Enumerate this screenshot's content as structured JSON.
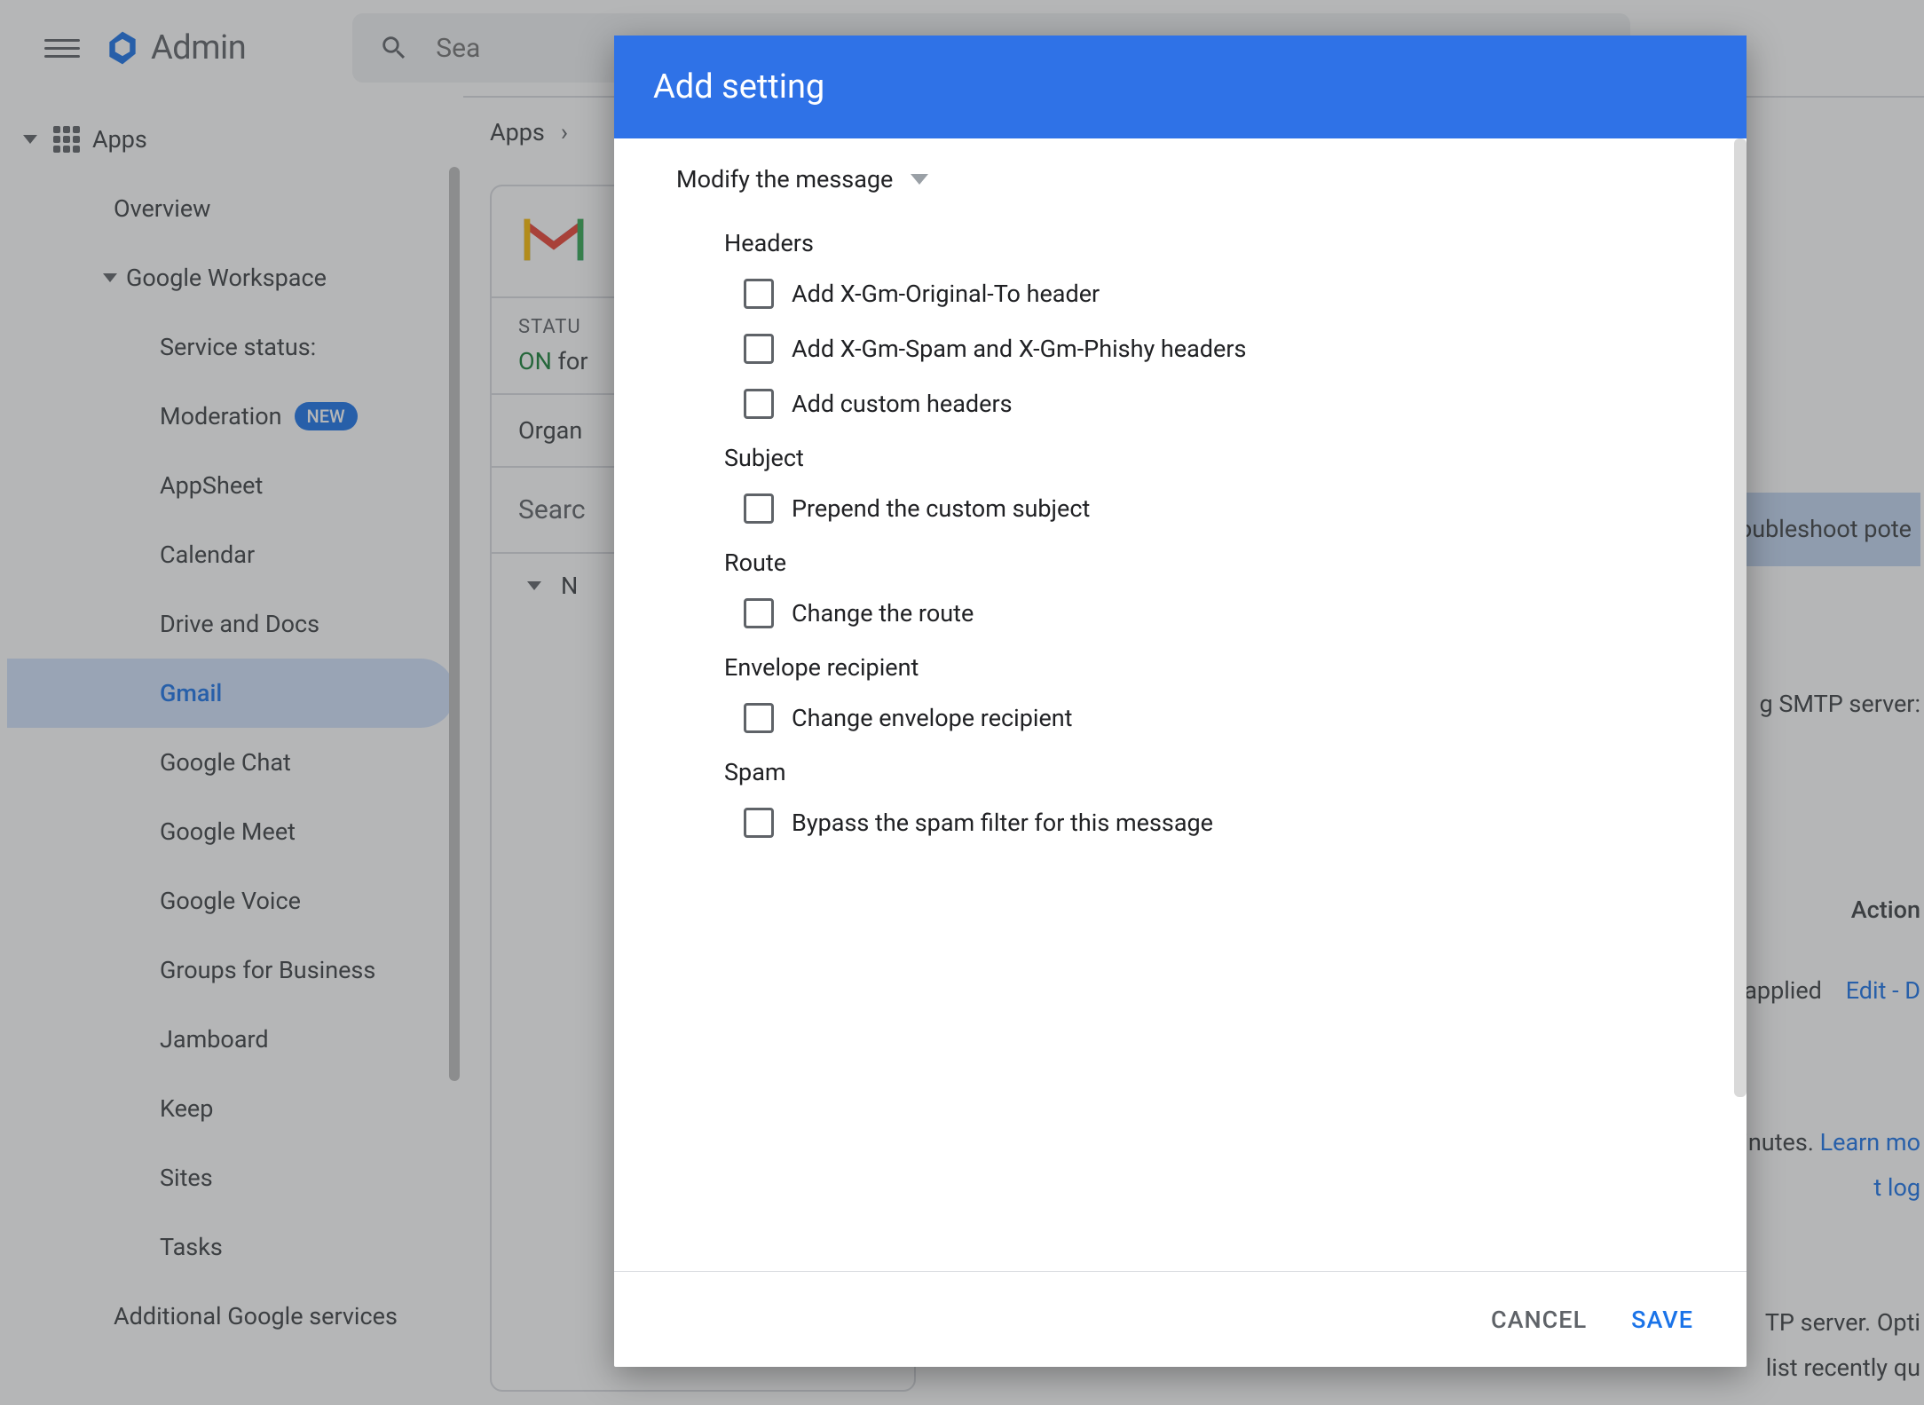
{
  "header": {
    "admin_label": "Admin",
    "search_placeholder": "Sea"
  },
  "sidebar": {
    "apps": "Apps",
    "overview": "Overview",
    "google_workspace": "Google Workspace",
    "items": [
      "Service status:",
      "Moderation",
      "AppSheet",
      "Calendar",
      "Drive and Docs",
      "Gmail",
      "Google Chat",
      "Google Meet",
      "Google Voice",
      "Groups for Business",
      "Jamboard",
      "Keep",
      "Sites",
      "Tasks"
    ],
    "new_badge": "NEW",
    "additional": "Additional Google services"
  },
  "breadcrumb": {
    "apps": "Apps"
  },
  "panel": {
    "status_label": "STATU",
    "status_value": "ON for",
    "organ": "Organ",
    "search_settings": "Searc",
    "expand_letter": "N"
  },
  "right": {
    "troubleshoot": "roubleshoot pote",
    "smtp": "g SMTP server:",
    "actions": "Action",
    "applied": "applied",
    "edit": "Edit - D",
    "minutes": "minutes.",
    "learn": "Learn mo",
    "tlog": "t log",
    "server": "TP server. Opti",
    "recent": "list recently qu"
  },
  "dialog": {
    "title": "Add setting",
    "modify": "Modify the message",
    "sections": {
      "headers": {
        "title": "Headers",
        "opts": [
          "Add X-Gm-Original-To header",
          "Add X-Gm-Spam and X-Gm-Phishy headers",
          "Add custom headers"
        ]
      },
      "subject": {
        "title": "Subject",
        "opts": [
          "Prepend the custom subject"
        ]
      },
      "route": {
        "title": "Route",
        "opts": [
          "Change the route"
        ]
      },
      "envelope": {
        "title": "Envelope recipient",
        "opts": [
          "Change envelope recipient"
        ]
      },
      "spam": {
        "title": "Spam",
        "opts": [
          "Bypass the spam filter for this message"
        ]
      }
    },
    "cancel": "CANCEL",
    "save": "SAVE"
  }
}
